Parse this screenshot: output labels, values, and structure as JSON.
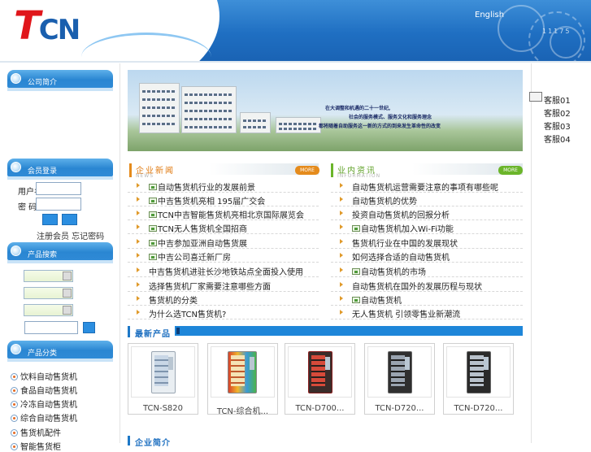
{
  "header": {
    "logo_t": "T",
    "logo_cn": "CN",
    "english_link": "English",
    "code": "11175"
  },
  "sidebar": {
    "panel1_title": "公司简介",
    "login": {
      "title": "会员登录",
      "user_label": "用户名",
      "pass_label": "密 码：",
      "links": "注册会员  忘记密码"
    },
    "search": {
      "title": "产品搜索"
    },
    "categories": {
      "title": "产品分类",
      "items": [
        "饮料自动售货机",
        "食品自动售货机",
        "冷冻自动售货机",
        "综合自动售货机",
        "售货机配件",
        "智能售货柜"
      ]
    }
  },
  "banner": {
    "line1": "在大调整和机遇的二十一世纪,",
    "line2": "社会的服务模式、服务文化和服务理念",
    "line3": "都将随着自助服务这一新的方式的到来发生革命性的改变"
  },
  "news_left": {
    "title": "企业新闻",
    "subtitle": "NEWS",
    "more": "MORE",
    "items": [
      {
        "text": "自动售货机行业的发展前景",
        "img": true
      },
      {
        "text": "中吉售货机亮相 195届广交会",
        "img": true
      },
      {
        "text": "TCN中吉智能售货机亮相北京国际展览会",
        "img": true
      },
      {
        "text": "TCN无人售货机全国招商",
        "img": true
      },
      {
        "text": "中吉参加亚洲自动售货展",
        "img": true
      },
      {
        "text": "中吉公司喜迁新厂房",
        "img": true
      },
      {
        "text": "中吉售货机进驻长沙地铁站点全面投入使用",
        "img": false
      },
      {
        "text": "选择售货机厂家需要注意哪些方面",
        "img": false
      },
      {
        "text": "售货机的分类",
        "img": false
      },
      {
        "text": "为什么选TCN售货机?",
        "img": false
      }
    ]
  },
  "news_right": {
    "title": "业内资讯",
    "subtitle": "INFORMATION",
    "more": "MORE",
    "items": [
      {
        "text": "自动售货机运营需要注意的事项有哪些呢",
        "img": false
      },
      {
        "text": "自动售货机的优势",
        "img": false
      },
      {
        "text": "投资自动售货机的回报分析",
        "img": false
      },
      {
        "text": "自动售货机加入Wi-Fi功能",
        "img": true
      },
      {
        "text": "售货机行业在中国的发展现状",
        "img": false
      },
      {
        "text": "如何选择合适的自动售货机",
        "img": false
      },
      {
        "text": "自动售货机的市场",
        "img": true
      },
      {
        "text": "自动售货机在国外的发展历程与现状",
        "img": false
      },
      {
        "text": "自动售货机",
        "img": true
      },
      {
        "text": "无人售货机 引领零售业新潮流",
        "img": false
      }
    ]
  },
  "products": {
    "title": "最新产品",
    "items": [
      {
        "caption": "TCN-S820"
      },
      {
        "caption": "TCN-综合机..."
      },
      {
        "caption": "TCN-D700..."
      },
      {
        "caption": "TCN-D720..."
      },
      {
        "caption": "TCN-D720..."
      }
    ]
  },
  "intro": {
    "title": "企业简介"
  },
  "right_float": {
    "items": [
      "客服01",
      "客服02",
      "客服03",
      "客服04"
    ]
  },
  "colors": {
    "header_blue": "#1f6fc2",
    "accent_orange": "#e07a10",
    "accent_green": "#5fa127",
    "product_blue": "#1e86d9"
  }
}
